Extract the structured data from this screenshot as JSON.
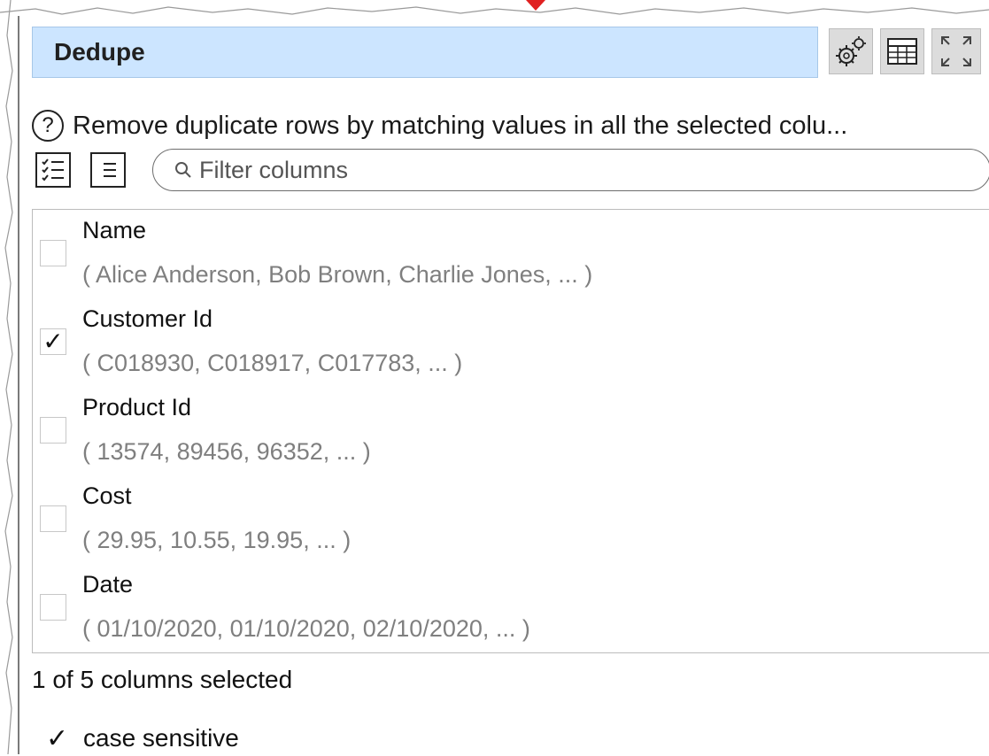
{
  "title": "Dedupe",
  "toolbar": {
    "settings_icon": "gears-icon",
    "table_icon": "table-icon",
    "expand_icon": "expand-icon"
  },
  "description": "Remove duplicate rows by matching values in all the selected colu...",
  "filter": {
    "placeholder": "Filter columns",
    "value": ""
  },
  "columns": [
    {
      "name": "Name",
      "values": "( Alice Anderson, Bob Brown, Charlie Jones, ... )",
      "checked": false,
      "mark": ""
    },
    {
      "name": "Customer Id",
      "values": "( C018930, C018917, C017783, ... )",
      "checked": true,
      "mark": "✓"
    },
    {
      "name": "Product Id",
      "values": "( 13574, 89456, 96352, ... )",
      "checked": false,
      "mark": ""
    },
    {
      "name": "Cost",
      "values": "( 29.95, 10.55, 19.95, ... )",
      "checked": false,
      "mark": ""
    },
    {
      "name": "Date",
      "values": "( 01/10/2020, 01/10/2020, 02/10/2020, ... )",
      "checked": false,
      "mark": ""
    }
  ],
  "status": "1 of 5 columns selected",
  "case_sensitive": {
    "label": "case sensitive",
    "checked": true,
    "mark": "✓"
  },
  "colors": {
    "title_bg": "#cce5ff",
    "button_bg": "#dcdcdc",
    "muted_text": "#7f7f7f"
  }
}
